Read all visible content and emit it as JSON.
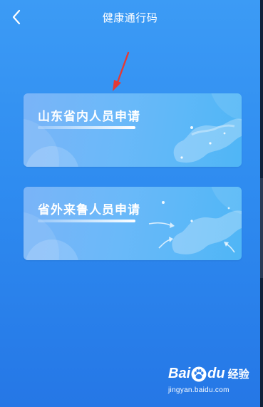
{
  "header": {
    "title": "健康通行码",
    "back_icon": "chevron-left-icon"
  },
  "cards": [
    {
      "label": "山东省内人员申请"
    },
    {
      "label": "省外来鲁人员申请"
    }
  ],
  "annotation": {
    "icon": "red-arrow-icon",
    "color": "#e53935"
  },
  "watermark": {
    "brand_part1": "Bai",
    "brand_part2": "du",
    "suffix": "经验",
    "url": "jingyan.baidu.com"
  },
  "colors": {
    "background": "#2f8cf0",
    "card": "#6ab9f9",
    "text": "#ffffff"
  }
}
